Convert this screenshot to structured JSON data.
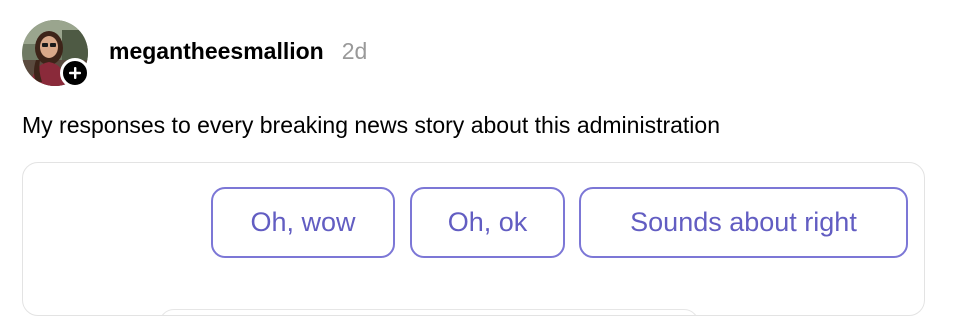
{
  "post": {
    "author": {
      "username": "megantheesmallion",
      "timestamp": "2d",
      "avatar_icon": "profile-photo",
      "follow_icon": "plus-icon"
    },
    "text": "My responses to every breaking news story about this administration",
    "reply_options": [
      {
        "label": "Oh, wow"
      },
      {
        "label": "Oh, ok"
      },
      {
        "label": "Sounds about right"
      }
    ]
  },
  "colors": {
    "accent_border": "#7c77d6",
    "accent_text": "#625dc2",
    "timestamp": "#999999",
    "card_border": "#e3e3e3"
  }
}
